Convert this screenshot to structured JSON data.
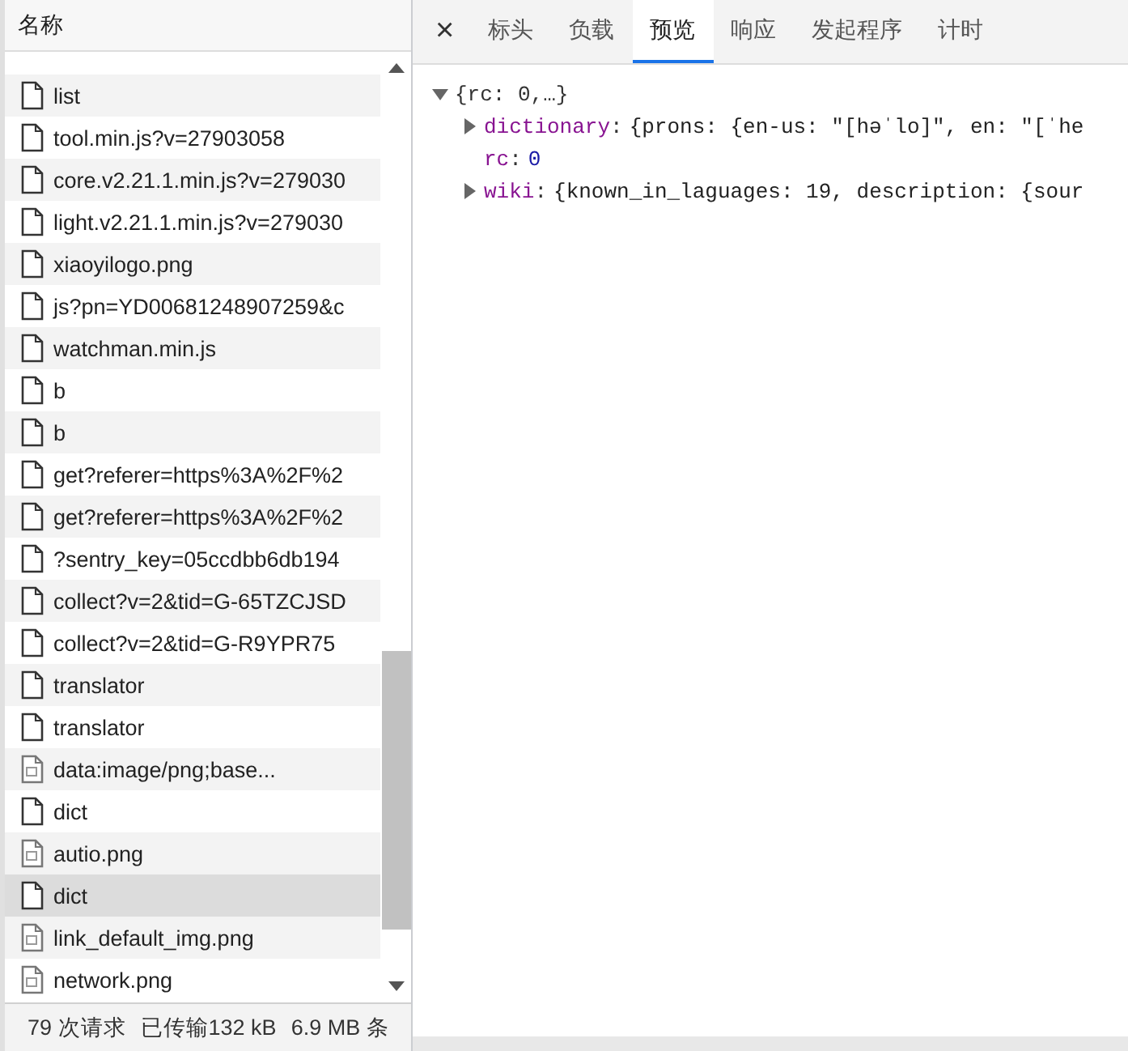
{
  "requests": {
    "column_1": "名称",
    "rows": [
      {
        "name": "list",
        "kind": "doc",
        "selected": false
      },
      {
        "name": "tool.min.js?v=27903058",
        "kind": "doc",
        "selected": false
      },
      {
        "name": "core.v2.21.1.min.js?v=279030",
        "kind": "doc",
        "selected": false
      },
      {
        "name": "light.v2.21.1.min.js?v=279030",
        "kind": "doc",
        "selected": false
      },
      {
        "name": "xiaoyilogo.png",
        "kind": "doc",
        "selected": false
      },
      {
        "name": "js?pn=YD00681248907259&c",
        "kind": "doc",
        "selected": false
      },
      {
        "name": "watchman.min.js",
        "kind": "doc",
        "selected": false
      },
      {
        "name": "b",
        "kind": "doc",
        "selected": false
      },
      {
        "name": "b",
        "kind": "doc",
        "selected": false
      },
      {
        "name": "get?referer=https%3A%2F%2",
        "kind": "doc",
        "selected": false
      },
      {
        "name": "get?referer=https%3A%2F%2",
        "kind": "doc",
        "selected": false
      },
      {
        "name": "?sentry_key=05ccdbb6db194",
        "kind": "doc",
        "selected": false
      },
      {
        "name": "collect?v=2&tid=G-65TZCJSD",
        "kind": "doc",
        "selected": false
      },
      {
        "name": "collect?v=2&tid=G-R9YPR75",
        "kind": "doc",
        "selected": false
      },
      {
        "name": "translator",
        "kind": "doc",
        "selected": false
      },
      {
        "name": "translator",
        "kind": "doc",
        "selected": false
      },
      {
        "name": "data:image/png;base...",
        "kind": "image",
        "selected": false
      },
      {
        "name": "dict",
        "kind": "doc",
        "selected": false
      },
      {
        "name": "autio.png",
        "kind": "image",
        "selected": false
      },
      {
        "name": "dict",
        "kind": "doc",
        "selected": true
      },
      {
        "name": "link_default_img.png",
        "kind": "image",
        "selected": false
      },
      {
        "name": "network.png",
        "kind": "image",
        "selected": false
      }
    ]
  },
  "status_bar": [
    "79 次请求",
    "已传输132 kB",
    "6.9 MB 条"
  ],
  "close": "×",
  "tabs": [
    {
      "label": "标头",
      "selected": false
    },
    {
      "label": "负载",
      "selected": false
    },
    {
      "label": "预览",
      "selected": true
    },
    {
      "label": "响应",
      "selected": false
    },
    {
      "label": "发起程序",
      "selected": false
    },
    {
      "label": "计时",
      "selected": false
    }
  ],
  "preview": {
    "root": "{rc: 0,…}",
    "expanded": true,
    "children": [
      {
        "key": "dictionary",
        "separator": ":",
        "value": "{prons: {en-us: \"[həˈlo]\", en: \"[ˈhe",
        "kind": "object",
        "expanded": false
      },
      {
        "key": "rc",
        "separator": ":",
        "value": "0",
        "kind": "number"
      },
      {
        "key": "wiki",
        "separator": ":",
        "value": "{known_in_laguages: 19, description: {sour",
        "kind": "object",
        "expanded": false
      }
    ]
  }
}
